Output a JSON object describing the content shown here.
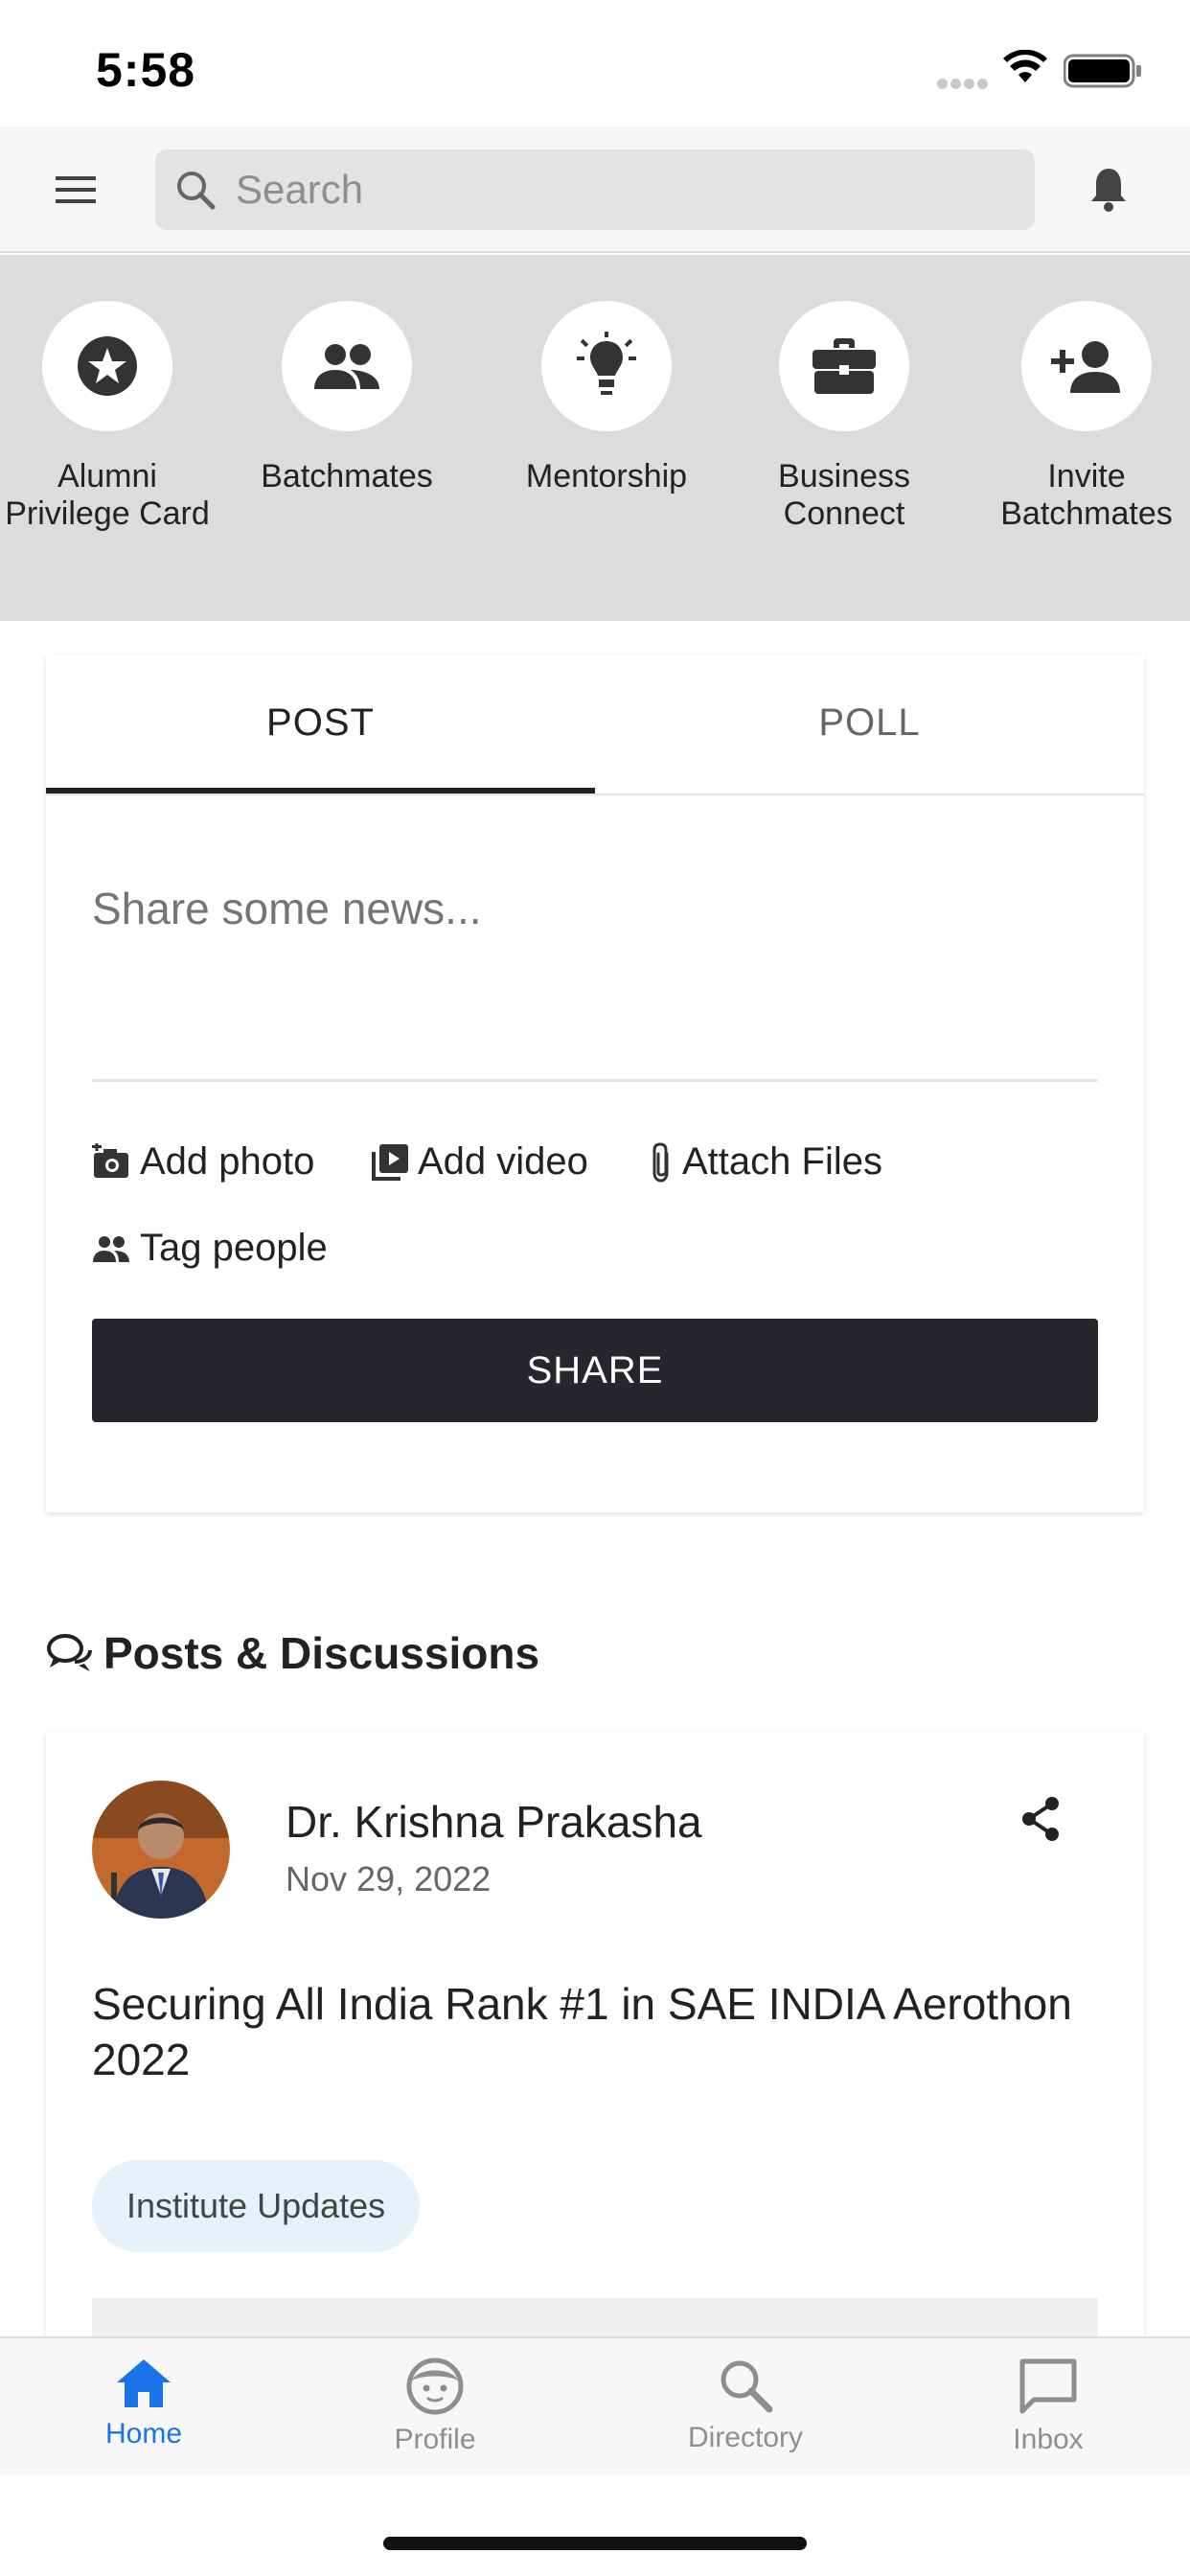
{
  "status_bar": {
    "time": "5:58"
  },
  "search": {
    "placeholder": "Search"
  },
  "quick_actions": [
    {
      "label": "Alumni Privilege Card",
      "icon": "star-badge-icon"
    },
    {
      "label": "Batchmates",
      "icon": "people-icon"
    },
    {
      "label": "Mentorship",
      "icon": "lightbulb-icon"
    },
    {
      "label": "Business Connect",
      "icon": "briefcase-icon"
    },
    {
      "label": "Invite Batchmates",
      "icon": "person-add-icon"
    }
  ],
  "composer": {
    "tabs": [
      "POST",
      "POLL"
    ],
    "active_tab": "POST",
    "placeholder": "Share some news...",
    "actions": {
      "add_photo": "Add photo",
      "add_video": "Add video",
      "attach_files": "Attach Files",
      "tag_people": "Tag people"
    },
    "share_label": "SHARE"
  },
  "feed": {
    "heading": "Posts & Discussions",
    "posts": [
      {
        "author": "Dr. Krishna Prakasha",
        "date": "Nov 29, 2022",
        "title": "Securing All India Rank #1 in SAE INDIA Aerothon 2022",
        "tag": "Institute Updates"
      }
    ]
  },
  "bottom_nav": {
    "items": [
      {
        "label": "Home",
        "icon": "home-icon",
        "active": true
      },
      {
        "label": "Profile",
        "icon": "profile-face-icon",
        "active": false
      },
      {
        "label": "Directory",
        "icon": "search-icon",
        "active": false
      },
      {
        "label": "Inbox",
        "icon": "chat-bubble-icon",
        "active": false
      }
    ]
  },
  "colors": {
    "accent": "#1a73e8",
    "inactive_nav": "#8e8e8e",
    "share_button": "#26262b",
    "tag_chip_bg": "#e6f1fc",
    "quick_strip_bg": "#dcdcdc"
  }
}
